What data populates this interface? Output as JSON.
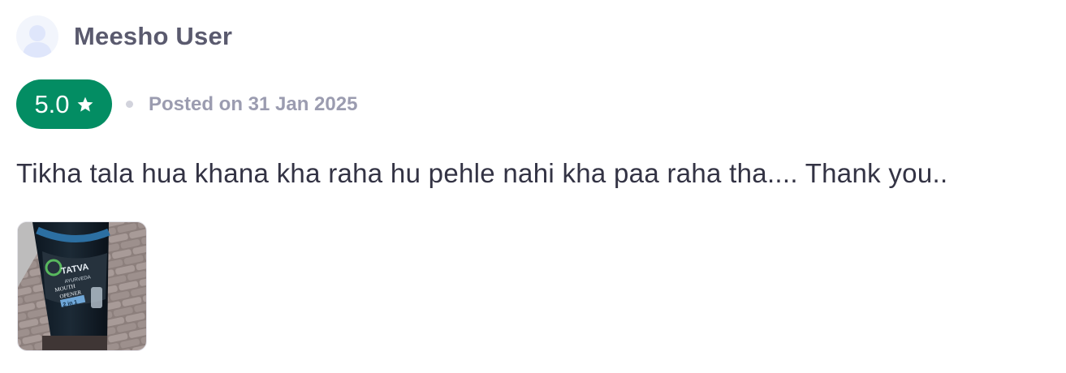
{
  "review": {
    "user_name": "Meesho User",
    "avatar_icon": "user-silhouette-icon",
    "rating": "5.0",
    "rating_icon": "star-icon",
    "rating_color": "#038d63",
    "posted": "Posted on 31 Jan 2025",
    "text": "Tikha tala hua khana kha raha hu pehle nahi kha paa raha tha.... Thank you..",
    "photo": {
      "brand": "TATVA",
      "sub_brand": "AYURVEDA",
      "label_lines": [
        "MOUTH",
        "OPENER",
        "2 in 1"
      ]
    }
  }
}
